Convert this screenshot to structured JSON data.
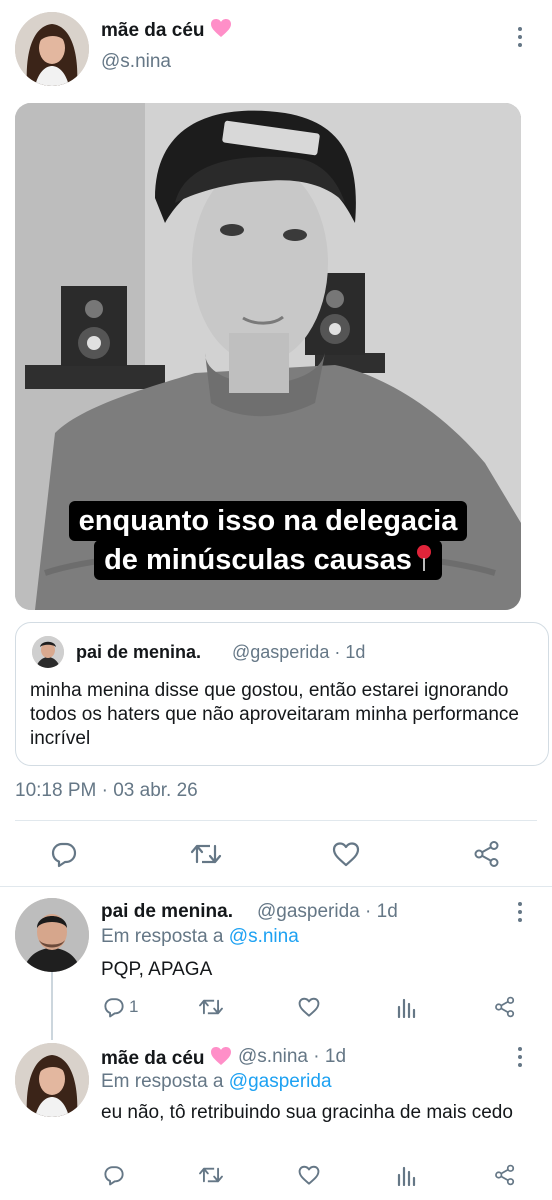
{
  "main_tweet": {
    "author_name": "mãe da céu",
    "handle": "@s.nina",
    "media_caption_line1": "enquanto isso na delegacia",
    "media_caption_line2": "de minúsculas causas",
    "quoted": {
      "author_name": "pai de menina.",
      "handle_time": "@gasperida · 1d",
      "text": "minha menina disse que gostou, então estarei ignorando todos os haters que não aproveitaram minha performance incrível"
    },
    "timestamp": "10:18 PM · 03 abr. 26"
  },
  "replies": [
    {
      "author_name": "pai de menina.",
      "handle_time": "@gasperida · 1d",
      "reply_prefix": "Em resposta a ",
      "reply_to": "@s.nina",
      "text": "PQP, APAGA",
      "reply_count": "1"
    },
    {
      "author_name": "mãe da céu",
      "handle_time": "@s.nina · 1d",
      "reply_prefix": "Em resposta a ",
      "reply_to": "@gasperida",
      "text": "eu não, tô retribuindo sua gracinha de mais cedo"
    }
  ],
  "colors": {
    "accent_link": "#1da1f2",
    "secondary_text": "#657786",
    "heart_emoji": "#ff8fc8",
    "pin_emoji": "#e0243a"
  },
  "icons": [
    "more-vertical-icon",
    "reply-icon",
    "retweet-icon",
    "like-icon",
    "share-icon",
    "analytics-icon",
    "pink-heart-emoji",
    "round-pushpin-emoji"
  ]
}
